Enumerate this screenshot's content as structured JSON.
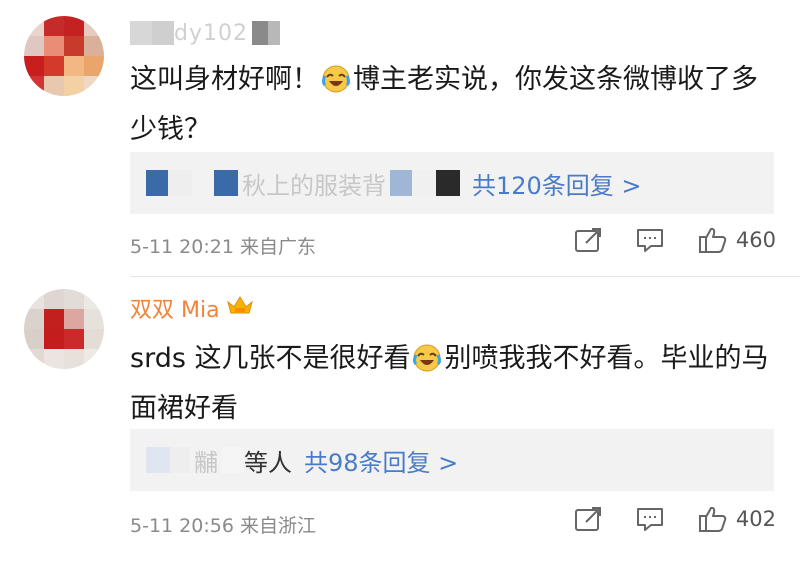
{
  "comments": [
    {
      "username": "dy102",
      "text": [
        "这叫身材好啊！",
        "博主老实说，你发这条微博收了多少钱？"
      ],
      "reply_preview": "秋上的服装背",
      "reply_link": "共120条回复 >",
      "meta": "5-11 20:21 来自广东",
      "likes": "460"
    },
    {
      "username": "双双 Mia",
      "text": [
        "srds 这几张不是很好看",
        "别喷我我不好看。毕业的马面裙好看"
      ],
      "reply_preview": "黼",
      "reply_suffix": "等人",
      "reply_link": "共98条回复 >",
      "meta": "5-11 20:56 来自浙江",
      "likes": "402"
    }
  ],
  "icons": {
    "emoji": "laughing-crying-emoji",
    "share": "share-icon",
    "comment": "comment-icon",
    "like": "thumbs-up-icon",
    "badge": "crown-icon"
  },
  "colors": {
    "link": "#4a7bc8",
    "username_vip": "#f2843a",
    "meta_text": "#8a8a8a",
    "reply_bg": "#f2f2f2"
  }
}
